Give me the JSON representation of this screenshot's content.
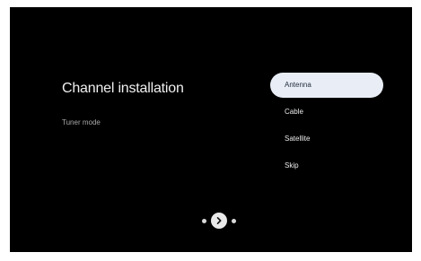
{
  "setup": {
    "title": "Channel installation",
    "subtitle": "Tuner mode"
  },
  "options": [
    {
      "label": "Antenna",
      "selected": true
    },
    {
      "label": "Cable",
      "selected": false
    },
    {
      "label": "Satellite",
      "selected": false
    },
    {
      "label": "Skip",
      "selected": false
    }
  ],
  "pager": {
    "next_icon": "chevron-right-icon"
  },
  "colors": {
    "background": "#000000",
    "selected_option_bg": "#e9eef6",
    "selected_option_text": "#1f2a3a",
    "text": "#ececec"
  }
}
